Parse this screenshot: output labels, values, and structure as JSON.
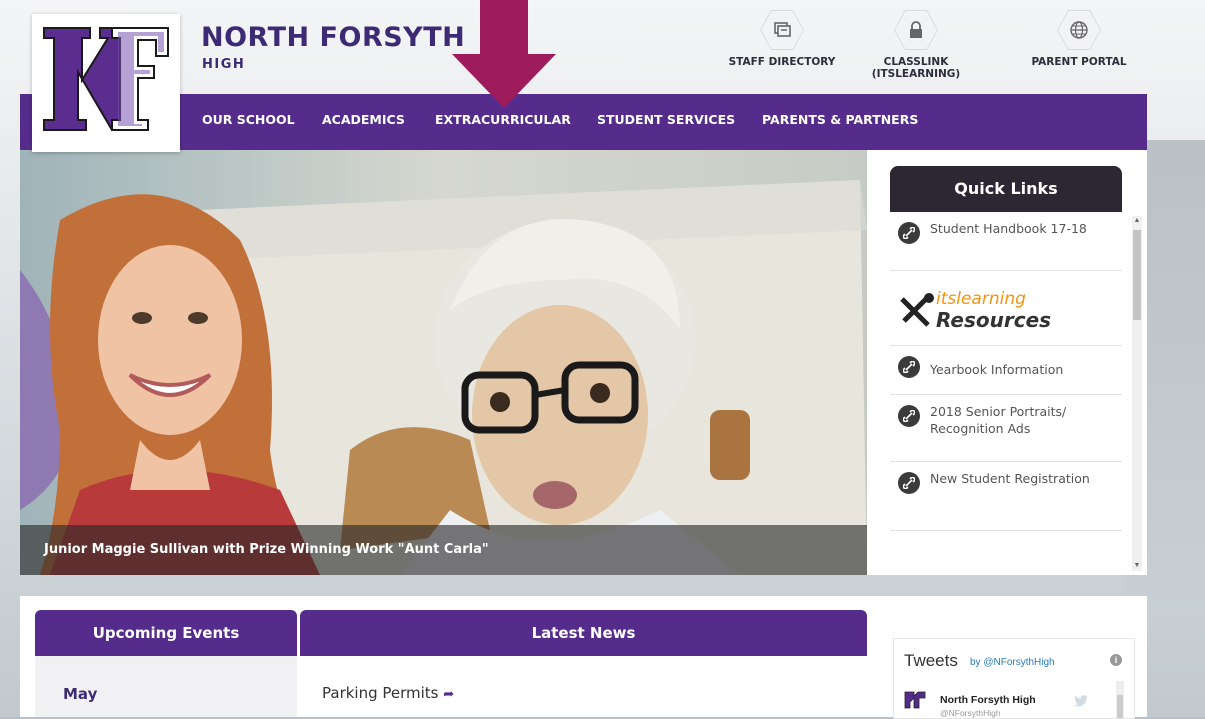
{
  "header": {
    "school_name": "NORTH FORSYTH",
    "school_sub": "HIGH",
    "utility_links": [
      {
        "label": "STAFF DIRECTORY",
        "icon": "directory-icon"
      },
      {
        "label": "CLASSLINK (ITSLEARNING)",
        "icon": "lock-icon"
      },
      {
        "label": "PARENT PORTAL",
        "icon": "globe-icon"
      }
    ]
  },
  "nav": {
    "items": [
      "OUR SCHOOL",
      "ACADEMICS",
      "EXTRACURRICULAR",
      "STUDENT SERVICES",
      "PARENTS & PARTNERS"
    ]
  },
  "hero": {
    "caption": "Junior Maggie Sullivan with Prize Winning Work \"Aunt Carla\""
  },
  "quick_links": {
    "title": "Quick Links",
    "items": [
      {
        "label": "Student Handbook 17-18"
      },
      {
        "label": "Yearbook Information"
      },
      {
        "label": "2018 Senior Portraits/ Recognition Ads"
      },
      {
        "label": "New Student Registration"
      }
    ],
    "promo": {
      "line1": "itslearning",
      "line2": "Resources"
    }
  },
  "bottom": {
    "events_tab": "Upcoming Events",
    "news_tab": "Latest News",
    "events_month": "May",
    "news_first": "Parking Permits",
    "tweets_title": "Tweets",
    "tweets_by": "by @NForsythHigh",
    "tweet_author": "North Forsyth High",
    "tweet_handle": "@NForsythHigh"
  },
  "colors": {
    "brand_purple": "#552c8c",
    "arrow": "#9e1b5c",
    "quicklinks_header": "#2c2732"
  }
}
